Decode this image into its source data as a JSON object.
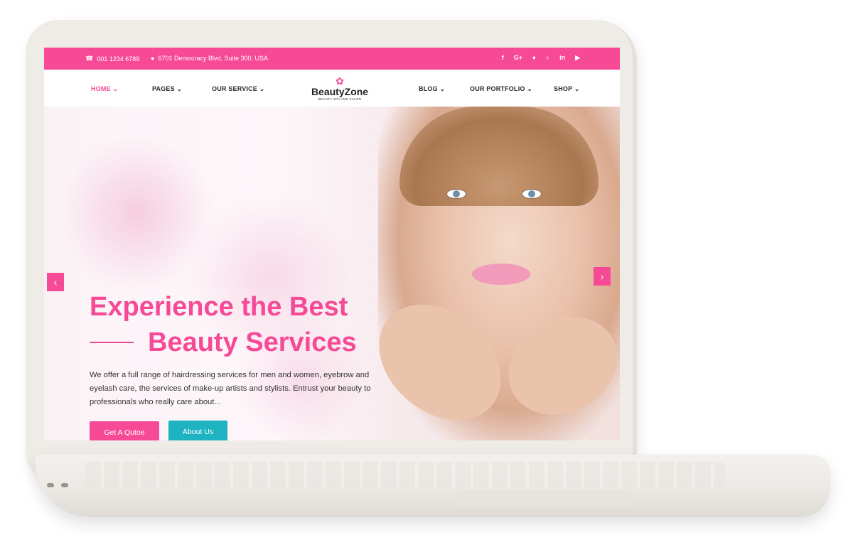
{
  "topbar": {
    "phone": "001 1234 6789",
    "address": "6701 Democracy Blvd, Suite 300, USA",
    "social": [
      "f",
      "G+",
      "t",
      "ig",
      "in",
      "yt"
    ]
  },
  "nav": {
    "left": [
      "HOME",
      "PAGES",
      "OUR SERVICE"
    ],
    "right": [
      "BLOG",
      "OUR PORTFOLIO",
      "SHOP"
    ]
  },
  "logo": {
    "name": "BeautyZone",
    "tagline": "BEAUTY SPA AND SALON"
  },
  "hero": {
    "headline_line1": "Experience the Best",
    "headline_line2": "Beauty Services",
    "paragraph": "We offer a full range of hairdressing services for men and women, eyebrow and eyelash care, the services of make-up artists and stylists. Entrust your beauty to professionals who really care about...",
    "cta_primary": "Get A Qutoe",
    "cta_secondary": "About Us",
    "prev_arrow": "‹",
    "next_arrow": "›"
  },
  "colors": {
    "accent": "#f64a96",
    "teal": "#1fb3c2"
  },
  "icons": {
    "phone": "phone-icon",
    "location": "map-marker-icon"
  }
}
